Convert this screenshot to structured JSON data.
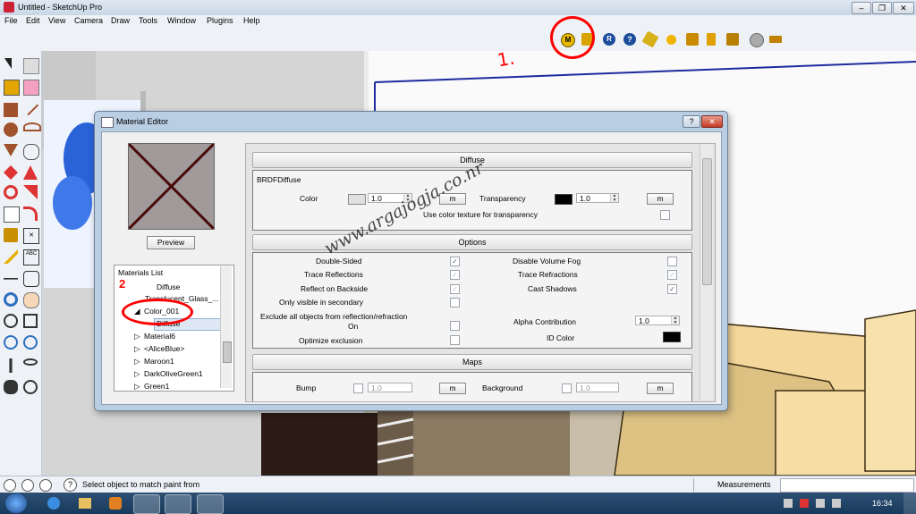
{
  "window": {
    "title": "Untitled - SketchUp Pro"
  },
  "menu": [
    "File",
    "Edit",
    "View",
    "Camera",
    "Draw",
    "Tools",
    "Window",
    "Plugins",
    "Help"
  ],
  "toolbar_icons": [
    "m-render-icon",
    "material-tag-icon",
    "r-render-icon",
    "help-icon",
    "tag-icon",
    "sphere-icon",
    "light-icon",
    "flag-icon",
    "lamp-icon",
    "ball-icon",
    "dimension-icon"
  ],
  "annotations": {
    "step1": "1.",
    "step2": "2",
    "watermark": "www.argajogja.co.nr"
  },
  "dialog": {
    "title": "Material Editor",
    "help_button": "?",
    "close_button": "✕",
    "preview_button": "Preview",
    "materials_list": {
      "label": "Materials List",
      "items": [
        "Diffuse",
        "Translucent_Glass_...",
        "Color_001",
        "Diffuse",
        "Material6",
        "<AliceBlue>",
        "Maroon1",
        "DarkOliveGreen1",
        "Green1"
      ]
    },
    "diffuse": {
      "header": "Diffuse",
      "group": "BRDFDiffuse",
      "color_label": "Color",
      "color_value": "1.0",
      "m_label": "m",
      "transparency_label": "Transparency",
      "transparency_value": "1.0",
      "use_color_texture": "Use color texture for transparency"
    },
    "options": {
      "header": "Options",
      "double_sided": "Double-Sided",
      "trace_reflections": "Trace Reflections",
      "reflect_backside": "Reflect on Backside",
      "only_visible": "Only visible in secondary",
      "exclude_all": "Exclude all objects from reflection/refraction",
      "on": "On",
      "optimize_exclusion": "Optimize exclusion",
      "disable_volume_fog": "Disable Volume Fog",
      "trace_refractions": "Trace Refractions",
      "cast_shadows": "Cast Shadows",
      "alpha_contribution": "Alpha Contribution",
      "alpha_value": "1.0",
      "id_color": "ID Color"
    },
    "maps": {
      "header": "Maps",
      "bump": "Bump",
      "bump_value": "1.0",
      "background": "Background",
      "background_value": "1.0",
      "m_label": "m"
    }
  },
  "status": {
    "message": "Select object to match paint from",
    "measurements": "Measurements"
  },
  "taskbar": {
    "time": "16:34"
  },
  "colors": {
    "accent_red": "#ff0000",
    "dialog_frame": "#b9cde3",
    "taskbar": "#1f4468"
  }
}
